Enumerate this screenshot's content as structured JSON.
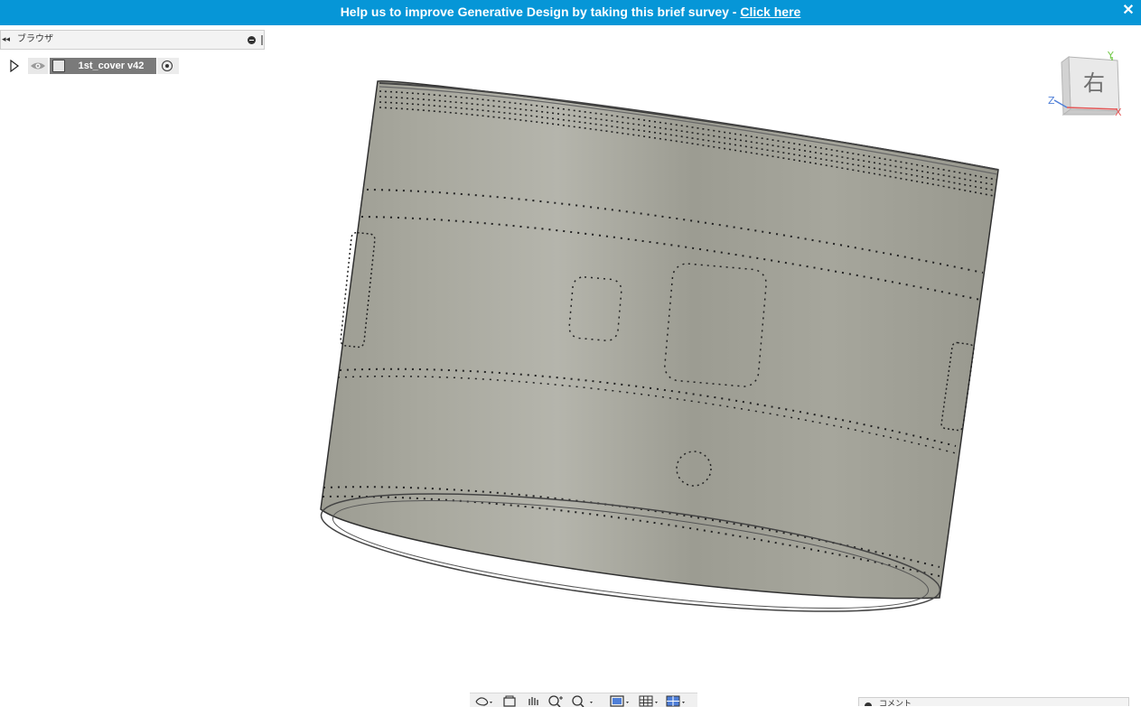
{
  "banner": {
    "message": "Help us to improve Generative Design by taking this brief survey - ",
    "link": "Click here",
    "close": "✕"
  },
  "browser": {
    "title": "ブラウザ",
    "collapse": "◂◂",
    "root_component": "1st_cover v42"
  },
  "viewcube": {
    "face": "右",
    "axes": {
      "x": "X",
      "y": "Y",
      "z": "Z"
    },
    "colors": {
      "x": "#e35757",
      "y": "#74c94a",
      "z": "#4f7fd8"
    }
  },
  "comments": {
    "label": "コメント"
  },
  "colors": {
    "banner": "#0696d7",
    "model_body": "#a7a79d"
  },
  "icons": [
    "rewind-icon",
    "minus-icon",
    "expand-arrow-icon",
    "eye-icon",
    "component-icon",
    "activate-radio-icon",
    "orbit-icon",
    "look-at-icon",
    "pan-icon",
    "zoom-icon",
    "zoom-window-icon",
    "display-settings-icon",
    "grid-icon",
    "viewport-icon"
  ]
}
